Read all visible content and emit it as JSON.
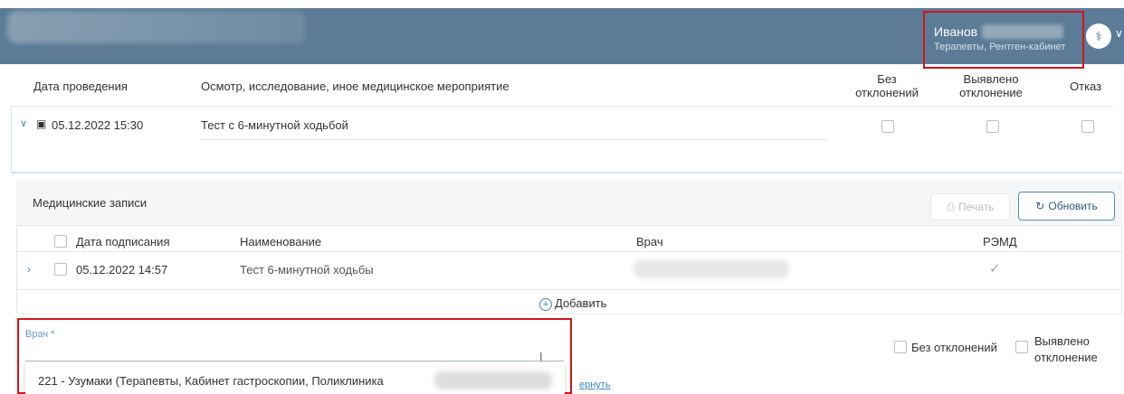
{
  "header": {
    "user_name": "Иванов",
    "user_department": "Терапевты, Рентген-кабинет",
    "avatar_icon": "stethoscope-icon"
  },
  "exam_table": {
    "columns": {
      "date": "Дата проведения",
      "event": "Осмотр, исследование, иное медицинское мероприятие",
      "no_deviation_1": "Без",
      "no_deviation_2": "отклонений",
      "deviation_1": "Выявлено",
      "deviation_2": "отклонение",
      "refusal": "Отказ"
    },
    "row": {
      "date": "05.12.2022 15:30",
      "event": "Тест с 6-минутной ходьбой"
    }
  },
  "medical_records": {
    "title": "Медицинские записи",
    "print_label": "Печать",
    "refresh_label": "Обновить",
    "columns": {
      "sign_date": "Дата подписания",
      "name": "Наименование",
      "doctor": "Врач",
      "remd": "РЭМД"
    },
    "row": {
      "sign_date": "05.12.2022 14:57",
      "name": "Тест 6-минутной ходьбы",
      "remd_mark": "✓"
    },
    "add_label": "Добавить"
  },
  "doctor_field": {
    "label": "Врач *",
    "dropdown_item": "221 - Узумаки       (Терапевты, Кабинет гастроскопии, Поликлиника",
    "link_fragment": "ернуть"
  },
  "bottom_checks": {
    "no_deviation": "Без отклонений",
    "deviation_1": "Выявлено",
    "deviation_2": "отклонение"
  }
}
